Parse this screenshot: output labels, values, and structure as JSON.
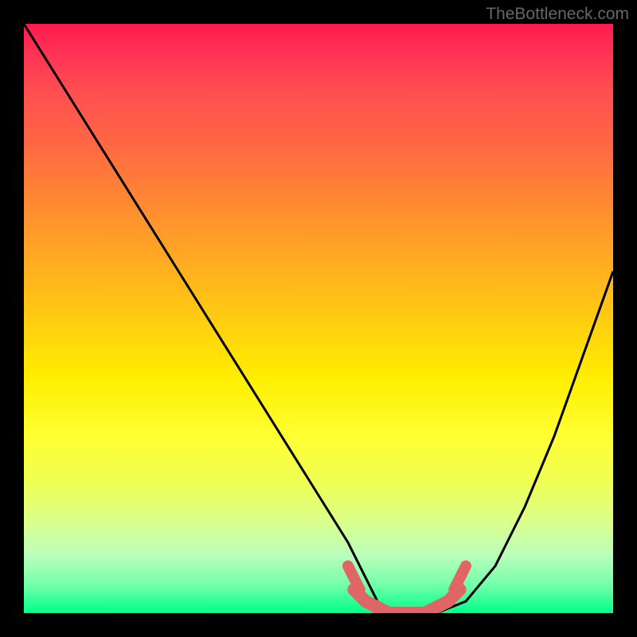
{
  "watermark": "TheBottleneck.com",
  "chart_data": {
    "type": "line",
    "title": "",
    "xlabel": "",
    "ylabel": "",
    "ylim": [
      0,
      100
    ],
    "xlim": [
      0,
      100
    ],
    "series": [
      {
        "name": "curve",
        "x": [
          0,
          5,
          10,
          15,
          20,
          25,
          30,
          35,
          40,
          45,
          50,
          55,
          58,
          60,
          63,
          66,
          70,
          75,
          80,
          85,
          90,
          95,
          100
        ],
        "values": [
          100,
          92,
          84,
          76,
          68,
          60,
          52,
          44,
          36,
          28,
          20,
          12,
          6,
          2,
          0,
          0,
          0,
          2,
          8,
          18,
          30,
          44,
          58
        ]
      },
      {
        "name": "highlight-bottom",
        "x": [
          56,
          58,
          60,
          62,
          64,
          66,
          68,
          70,
          72,
          74
        ],
        "values": [
          4,
          2,
          1,
          0,
          0,
          0,
          0,
          1,
          2,
          4
        ]
      }
    ],
    "gradient_colors": {
      "top": "#ff1a4d",
      "mid": "#ffee00",
      "bottom": "#00ff88"
    },
    "highlight_color": "#e06666"
  }
}
